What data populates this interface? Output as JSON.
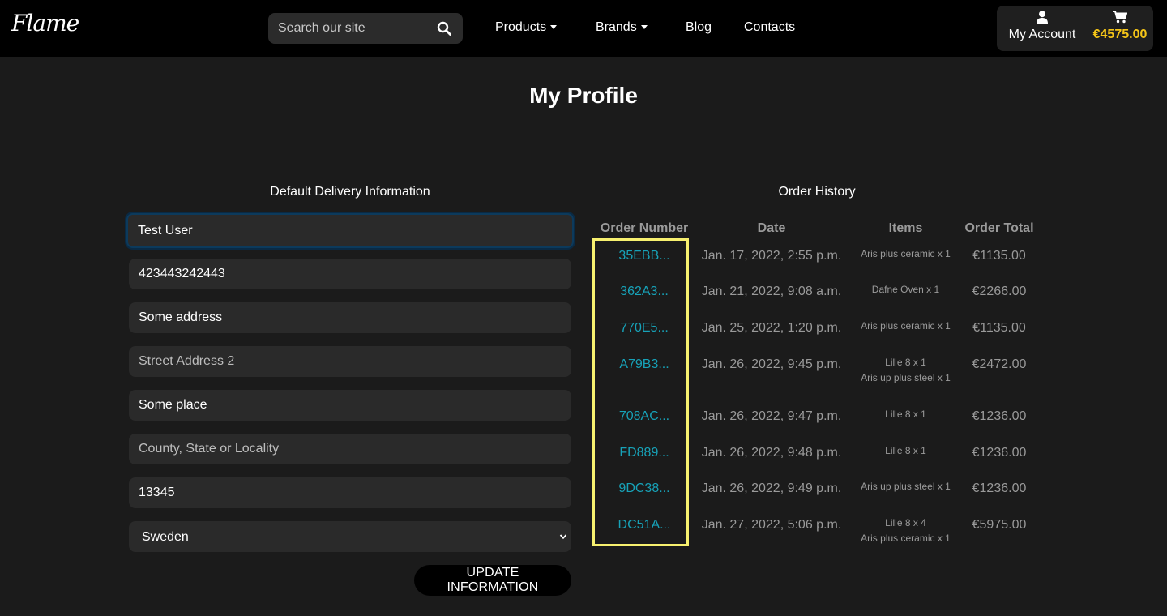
{
  "header": {
    "logo_text": "Flame",
    "search_placeholder": "Search our site",
    "nav": [
      "Products",
      "Brands",
      "Blog",
      "Contacts"
    ],
    "account_label": "My Account",
    "cart_total": "€4575.00",
    "cart_color": "#f5c518"
  },
  "page": {
    "title": "My Profile"
  },
  "delivery": {
    "title": "Default Delivery Information",
    "full_name": "Test User",
    "phone": "423443242443",
    "street1": "Some address",
    "street2_placeholder": "Street Address 2",
    "town": "Some place",
    "county_placeholder": "County, State or Locality",
    "postcode": "13345",
    "country": "Sweden",
    "update_label": "UPDATE INFORMATION"
  },
  "orders": {
    "title": "Order History",
    "columns": [
      "Order Number",
      "Date",
      "Items",
      "Order Total"
    ],
    "rows": [
      {
        "number": "35EBB...",
        "date": "Jan. 17, 2022, 2:55 p.m.",
        "items": [
          "Aris plus ceramic x 1"
        ],
        "total": "€1135.00"
      },
      {
        "number": "362A3...",
        "date": "Jan. 21, 2022, 9:08 a.m.",
        "items": [
          "Dafne Oven x 1"
        ],
        "total": "€2266.00"
      },
      {
        "number": "770E5...",
        "date": "Jan. 25, 2022, 1:20 p.m.",
        "items": [
          "Aris plus ceramic x 1"
        ],
        "total": "€1135.00"
      },
      {
        "number": "A79B3...",
        "date": "Jan. 26, 2022, 9:45 p.m.",
        "items": [
          "Lille 8 x 1",
          "Aris up plus steel x 1"
        ],
        "total": "€2472.00"
      },
      {
        "number": "708AC...",
        "date": "Jan. 26, 2022, 9:47 p.m.",
        "items": [
          "Lille 8 x 1"
        ],
        "total": "€1236.00"
      },
      {
        "number": "FD889...",
        "date": "Jan. 26, 2022, 9:48 p.m.",
        "items": [
          "Lille 8 x 1"
        ],
        "total": "€1236.00"
      },
      {
        "number": "9DC38...",
        "date": "Jan. 26, 2022, 9:49 p.m.",
        "items": [
          "Aris up plus steel x 1"
        ],
        "total": "€1236.00"
      },
      {
        "number": "DC51A...",
        "date": "Jan. 27, 2022, 5:06 p.m.",
        "items": [
          "Lille 8 x 4",
          "Aris plus ceramic x 1"
        ],
        "total": "€5975.00"
      }
    ],
    "link_color": "#17a2b8",
    "highlight_color": "#f7f06f"
  }
}
